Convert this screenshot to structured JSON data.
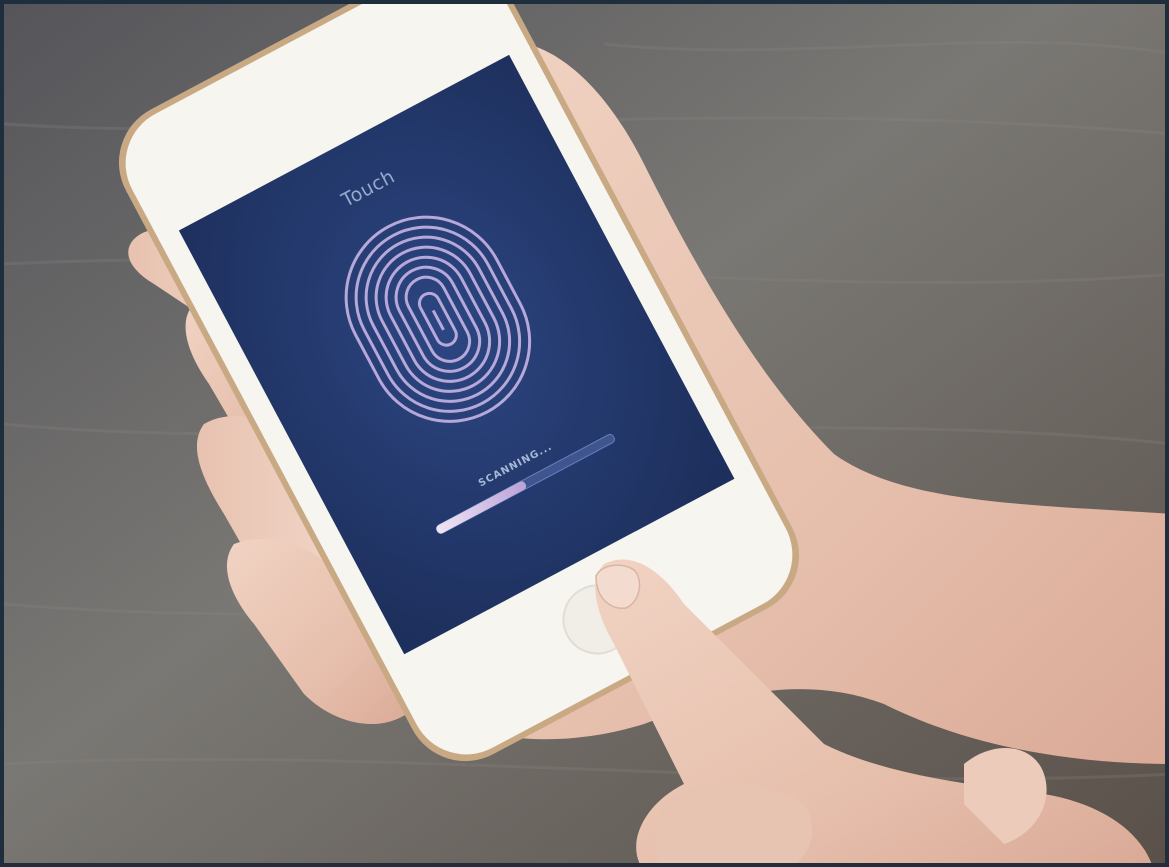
{
  "phone_screen": {
    "title": "Touch",
    "status": "SCANNING...",
    "scan_progress": 0.5,
    "background_color": "#23386a",
    "fingerprint_color": "#c6b4e4"
  },
  "scene": {
    "tabletop_color": "#6b6a66",
    "phone_body_color": "#f6f4ef",
    "skin_color": "#e9c6b4"
  }
}
